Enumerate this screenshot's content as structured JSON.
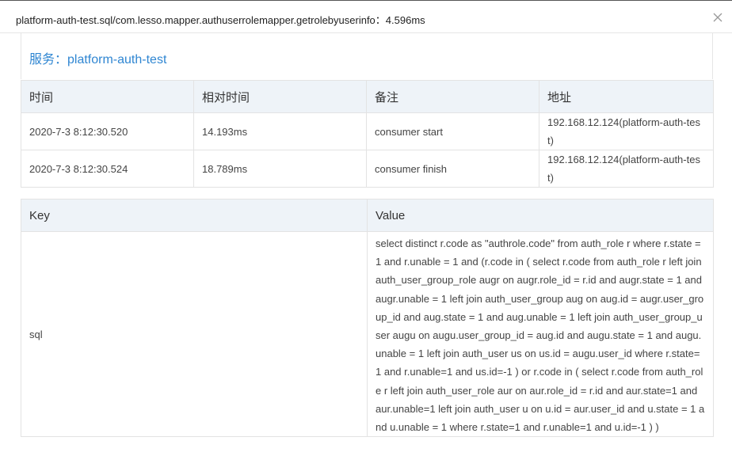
{
  "modal": {
    "title": "platform-auth-test.sql/com.lesso.mapper.authuserrolemapper.getrolebyuserinfo：4.596ms"
  },
  "service": {
    "label": "服务：platform-auth-test"
  },
  "trace_table": {
    "headers": [
      "时间",
      "相对时间",
      "备注",
      "地址"
    ],
    "rows": [
      [
        "2020-7-3 8:12:30.520",
        "14.193ms",
        "consumer start",
        "192.168.12.124(platform-auth-test)"
      ],
      [
        "2020-7-3 8:12:30.524",
        "18.789ms",
        "consumer finish",
        "192.168.12.124(platform-auth-test)"
      ]
    ]
  },
  "kv_table": {
    "headers": [
      "Key",
      "Value"
    ],
    "rows": [
      {
        "key": "sql",
        "value": "select distinct r.code as \"authrole.code\" from auth_role r where r.state = 1 and r.unable = 1 and (r.code in ( select r.code from auth_role r left join auth_user_group_role augr on augr.role_id = r.id and augr.state = 1 and augr.unable = 1 left join auth_user_group aug on aug.id = augr.user_group_id and aug.state = 1 and aug.unable = 1 left join auth_user_group_user augu on augu.user_group_id = aug.id and augu.state = 1 and augu.unable = 1 left join auth_user us on us.id = augu.user_id where r.state=1 and r.unable=1 and us.id=-1 ) or r.code in ( select r.code from auth_role r left join auth_user_role aur on aur.role_id = r.id and aur.state=1 and aur.unable=1 left join auth_user u on u.id = aur.user_id and u.state = 1 and u.unable = 1 where r.state=1 and r.unable=1 and u.id=-1 ) )"
      }
    ]
  },
  "icons": {
    "close": "close-icon"
  },
  "colors": {
    "service_title": "#2f86d2",
    "header_bg": "#eef3f8"
  }
}
